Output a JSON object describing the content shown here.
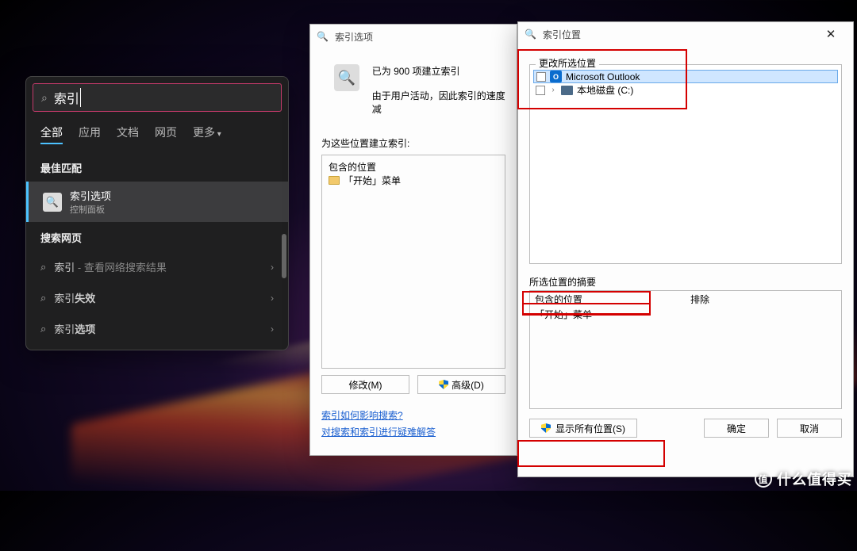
{
  "search": {
    "query": "索引",
    "tabs": {
      "all": "全部",
      "apps": "应用",
      "docs": "文档",
      "web": "网页",
      "more": "更多"
    },
    "best_match_header": "最佳匹配",
    "best_match": {
      "title": "索引选项",
      "subtitle": "控制面板"
    },
    "web_header": "搜索网页",
    "rows": [
      {
        "label": "索引",
        "suffix": " - 查看网络搜索结果"
      },
      {
        "label": "索引",
        "bold": "失效"
      },
      {
        "label": "索引",
        "bold": "选项"
      }
    ]
  },
  "dlg1": {
    "title": "索引选项",
    "status1": "已为 900 项建立索引",
    "status2": "由于用户活动，因此索引的速度减",
    "locations_label": "为这些位置建立索引:",
    "included_header": "包含的位置",
    "included_item": "「开始」菜单",
    "modify_btn": "修改(M)",
    "advanced_btn": "高级(D)",
    "link1": "索引如何影响搜索?",
    "link2": "对搜索和索引进行疑难解答"
  },
  "dlg2": {
    "title": "索引位置",
    "change_label": "更改所选位置",
    "outlook": "Microsoft Outlook",
    "local_disk": "本地磁盘 (C:)",
    "summary_label": "所选位置的摘要",
    "included_header": "包含的位置",
    "included_item": "「开始」菜单",
    "excluded_header": "排除",
    "show_all_btn": "显示所有位置(S)",
    "ok_btn": "确定",
    "cancel_btn": "取消"
  },
  "watermark": "什么值得买"
}
